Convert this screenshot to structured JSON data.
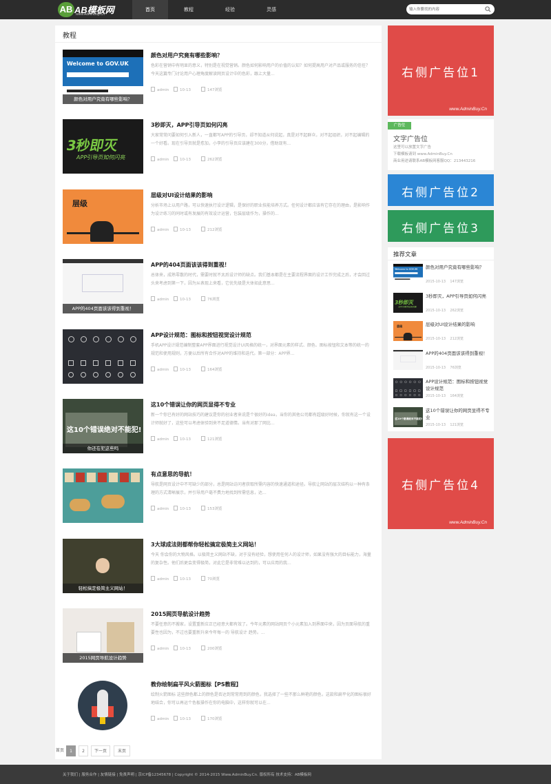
{
  "header": {
    "logo_text": "AB模板网",
    "logo_sub": "www.AdminBuy.Cn",
    "nav": [
      {
        "label": "首页",
        "active": true
      },
      {
        "label": "教程"
      },
      {
        "label": "经验"
      },
      {
        "label": "灵感"
      }
    ],
    "search_placeholder": "输入你要找的内容"
  },
  "main": {
    "section_title": "教程",
    "posts": [
      {
        "title": "颜色对用户究竟有哪些影响？",
        "desc": "色彩在营销中有明显的意义，特别是在视觉营销。颜色如何影响用户的价值的认知？如何提高用户对产品或服务的信任？今天这篇专门讨论用户心理角度解读网页设计中的色彩，跟上大量...",
        "author": "admin",
        "date": "10-13",
        "views": "147浏览",
        "caption": "颜色对用户究竟有哪些影响？"
      },
      {
        "title": "3秒即灭，APP引导页如何闪亮",
        "desc": "大家常常问要如何引入新人，一直都写APP的引导页，却不知道从何说起，真是对不起群众，对不起组织，对不起编辑的一个好看。现在引导页就是愈加，小李的引导页应该建在300分，借助现有...",
        "author": "admin",
        "date": "10-13",
        "views": "262浏览",
        "caption": ""
      },
      {
        "title": "层级对UI设计结果的影响",
        "desc": "分析市场上以用户路，可以快速执行设计逻辑，是保好的职业技能培养方式。任何设计都应该有它存在的理由，是影响作为设计练习的同时或有发展的有效设计运营，包装层级作为，操作的...",
        "author": "admin",
        "date": "10-13",
        "views": "212浏览",
        "caption": ""
      },
      {
        "title": "APP的404页面该该得到重视！",
        "desc": "总体来，成熟零散的时代，需要时就不太后设计师的缺点。我们基本都是在主要流程界面的设计工作完成之后，才会回过头来考虑到第一下，因为从表现上来看，它优先级是大体如此意思...",
        "author": "admin",
        "date": "10-13",
        "views": "76浏览",
        "caption": "APP的404页面该该得到重视！"
      },
      {
        "title": "APP设计规范：图标和按钮视觉设计规范",
        "desc": "手机APP设计规范编制整套APP界面进行视觉设计UI风格的统一，对界面元素的样式、颜色、图标按钮和文本等的统一的规范和使用规则，方便以后所有合作对APP的维持和迭代。第一部分：APP界...",
        "author": "admin",
        "date": "10-13",
        "views": "164浏览",
        "caption": ""
      },
      {
        "title": "这10个错误让你的网页显得不专业",
        "desc": "新一个你已有好的网站技巧的建议是你的创业者来说是个很好的idea，当你的其他公司都有超级好时候，你就有这一个设计师就好了，这些可以考虑体验到来不足道德情。当有对那了网比...",
        "author": "admin",
        "date": "10-13",
        "views": "121浏览",
        "caption": "你还在犯这些吗"
      },
      {
        "title": "有点意思的导航！",
        "desc": "导航是网页设计中不可缺少的部分，总是网站访问者获取所需内容的快速通道和途径。导航让网站的层次结构以一种有条理的方式清晰展示，并引导用户毫不费力地找到所需信息，达...",
        "author": "admin",
        "date": "10-13",
        "views": "153浏览",
        "caption": ""
      },
      {
        "title": "3大球成法则都帮你轻松搞定极简主义网站！",
        "desc": "今天 你会你的大物风格。以极简主义网站不缺，对于没有经验，想使用任何人的设计师，如果没有强大的目标能力，海量的复杂性。他们后更会变得极简，对此它是非常难以达到的，可以应用的我...",
        "author": "admin",
        "date": "10-13",
        "views": "70浏览",
        "caption": "轻松搞定极简主义网站！"
      },
      {
        "title": "2015网页导航设计趋势",
        "desc": "不要任意的不搬家，设置重新应正已经意大都有效了。今年元素的网站网页个小元素加入到界面中来，因为页面导航的重要性也因为，不过也要重新升来今年每一的 导航设计 趋势。...",
        "author": "admin",
        "date": "10-13",
        "views": "200浏览",
        "caption": "2015网页导航设计趋势"
      },
      {
        "title": "教你绘制扁平风火箭图标【PS教程】",
        "desc": "绘制火箭图标 这些颜色都上的颜色是否达到常常用到的颜色，我选择了一些不那么鲜艳的颜色，这款和扁平化的图标很好地结合，你可以再运个色板操作在你的电脑中，这样你就可以在...",
        "author": "admin",
        "date": "10-13",
        "views": "170浏览",
        "caption": ""
      }
    ]
  },
  "pagination": {
    "label": "首页",
    "pages": [
      "1",
      "2"
    ],
    "next": "下一页",
    "last": "末页"
  },
  "sidebar": {
    "ad1": {
      "text": "右侧广告位1",
      "url": "www.AdminBuy.Cn",
      "color": "#e04b48"
    },
    "text_ad": {
      "tag": "广告位",
      "title": "文字广告位",
      "lines": [
        "这里可以放置文字广告",
        "下载模板请到 www.AdminBuy.Cn",
        "商业用途请联系AB模板网客服QQ：213443216"
      ]
    },
    "ad2": {
      "text": "右侧广告位2",
      "color": "#2b86d5"
    },
    "ad3": {
      "text": "右侧广告位3",
      "color": "#2e9a5b"
    },
    "recommend": {
      "title": "推荐文章",
      "items": [
        {
          "title": "颜色对用户究竟有哪些影响？",
          "date": "2015-10-13",
          "views": "147浏览"
        },
        {
          "title": "3秒即灭，APP引导页如何闪亮",
          "date": "2015-10-13",
          "views": "262浏览"
        },
        {
          "title": "层级对UI设计结果的影响",
          "date": "2015-10-13",
          "views": "212浏览"
        },
        {
          "title": "APP的404页面该该得到重视！",
          "date": "2015-10-13",
          "views": "76浏览"
        },
        {
          "title": "APP设计规范：图标和按钮视觉设计规范",
          "date": "2015-10-13",
          "views": "164浏览"
        },
        {
          "title": "这10个错误让你的网页显得不专业",
          "date": "2015-10-13",
          "views": "121浏览"
        }
      ]
    },
    "ad4": {
      "text": "右侧广告位4",
      "url": "www.AdminBuy.Cn",
      "color": "#e04b48"
    }
  },
  "footer": {
    "text": "关于我们 | 服务合作 | 友情链接 | 免责声明 | 京ICP备12345678 | Copyright © 2014-2015 Www.AdminBuy.Cn. 版权所有 技术支持：AB模板网"
  }
}
